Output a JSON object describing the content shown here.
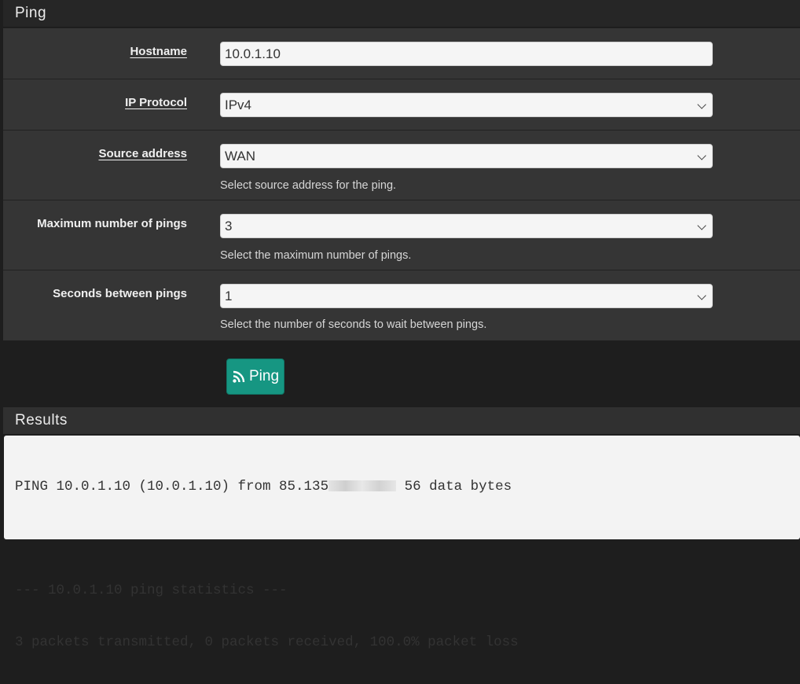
{
  "ping_panel": {
    "title": "Ping",
    "hostname": {
      "label": "Hostname",
      "value": "10.0.1.10"
    },
    "ip_protocol": {
      "label": "IP Protocol",
      "value": "IPv4"
    },
    "source_address": {
      "label": "Source address",
      "value": "WAN",
      "help": "Select source address for the ping."
    },
    "max_pings": {
      "label": "Maximum number of pings",
      "value": "3",
      "help": "Select the maximum number of pings."
    },
    "seconds_between": {
      "label": "Seconds between pings",
      "value": "1",
      "help": "Select the number of seconds to wait between pings."
    }
  },
  "ping_button": {
    "label": "Ping",
    "icon": "rss-icon",
    "color": "#169682"
  },
  "results": {
    "title": "Results",
    "line1_prefix": "PING 10.0.1.10 (10.0.1.10) from 85.135",
    "line1_suffix": " 56 data bytes",
    "line3": "--- 10.0.1.10 ping statistics ---",
    "line4": "3 packets transmitted, 0 packets received, 100.0% packet loss"
  }
}
